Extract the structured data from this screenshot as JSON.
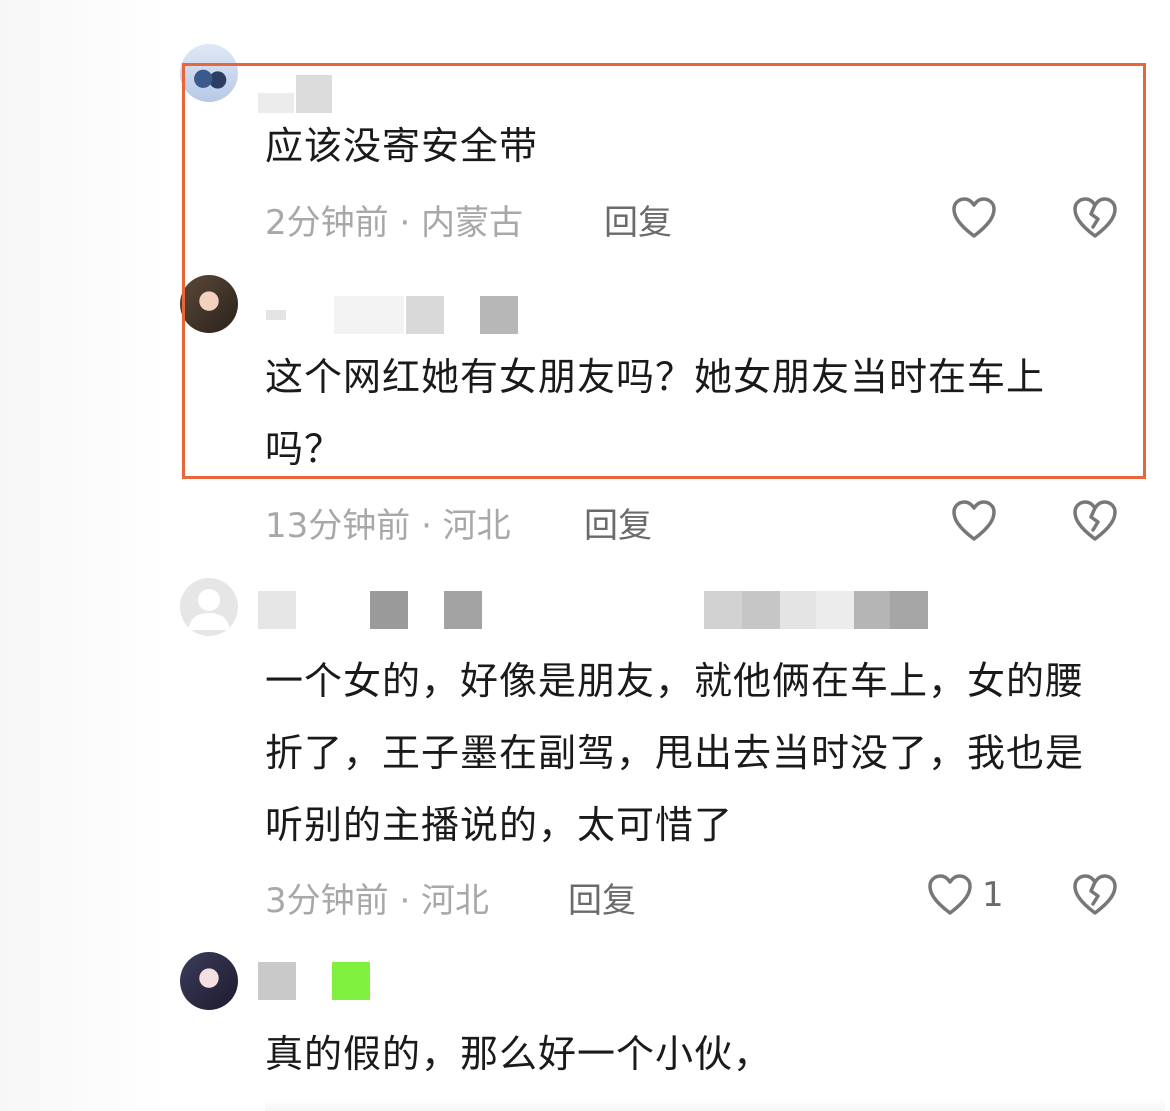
{
  "comments": [
    {
      "text": "应该没寄安全带",
      "meta": "2分钟前 · 内蒙古",
      "reply_label": "回复",
      "like_count": ""
    },
    {
      "text": "这个网红她有女朋友吗？她女朋友当时在车上吗？",
      "meta": "13分钟前 · 河北",
      "reply_label": "回复",
      "like_count": ""
    },
    {
      "text": "一个女的，好像是朋友，就他俩在车上，女的腰折了，王子墨在副驾，甩出去当时没了，我也是听别的主播说的，太可惜了",
      "meta": "3分钟前 · 河北",
      "reply_label": "回复",
      "like_count": "1"
    },
    {
      "text": "真的假的，那么好一个小伙，",
      "meta": "",
      "reply_label": "",
      "like_count": ""
    }
  ],
  "colors": {
    "highlight_border": "#e9663a",
    "meta_gray": "#a8a8a8",
    "text": "#1a1a1a"
  },
  "icons": [
    "heart-outline-icon",
    "broken-heart-icon",
    "default-user-icon"
  ]
}
